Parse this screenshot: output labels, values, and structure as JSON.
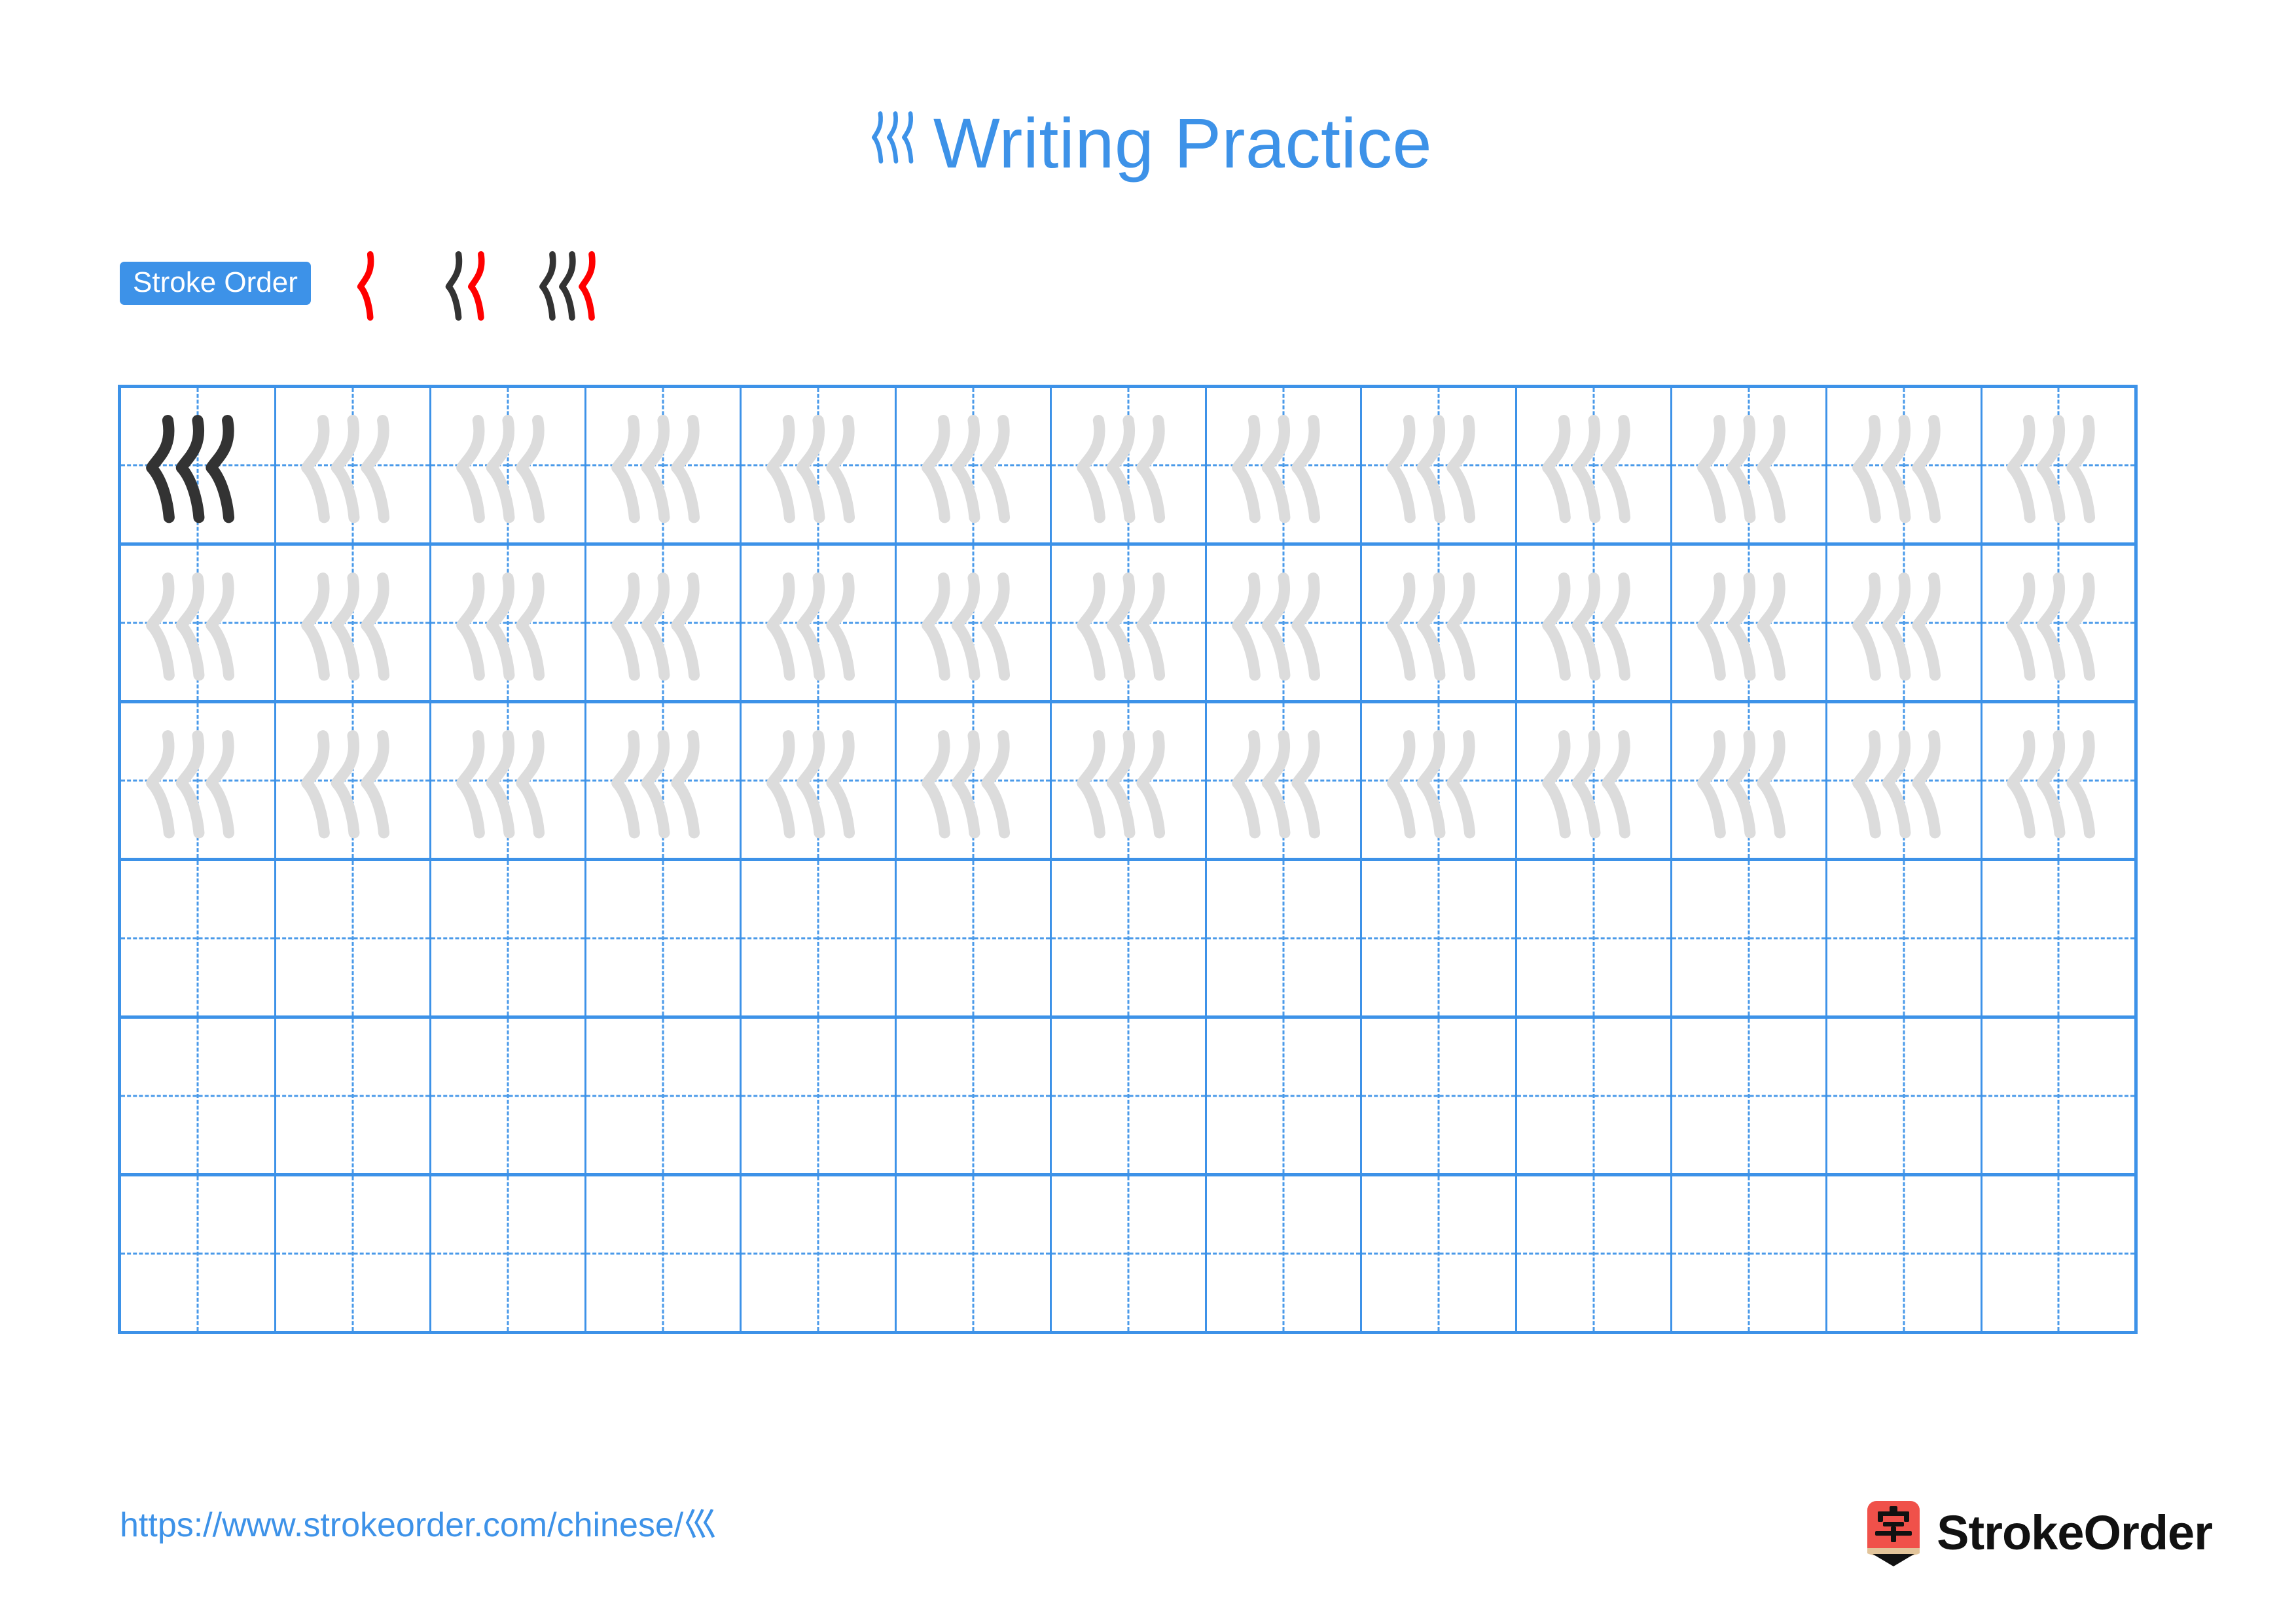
{
  "character": "巛",
  "title": {
    "character": "巛",
    "text": "Writing Practice",
    "color": "#3d92e8"
  },
  "stroke_order": {
    "badge_label": "Stroke Order",
    "badge_bg": "#3d92e8",
    "badge_text_color": "#ffffff",
    "new_stroke_color": "#ff0000",
    "previous_stroke_color": "#333333",
    "total_strokes": 3,
    "steps": [
      {
        "step": 1,
        "strokes_shown": 1,
        "new_stroke_index": 1
      },
      {
        "step": 2,
        "strokes_shown": 2,
        "new_stroke_index": 2
      },
      {
        "step": 3,
        "strokes_shown": 3,
        "new_stroke_index": 3
      }
    ]
  },
  "grid": {
    "rows": 6,
    "columns": 13,
    "line_color": "#3d92e8",
    "guide_color": "#4a9ae9",
    "dark_glyph_color": "#333333",
    "traced_glyph_color": "#dcdcdc",
    "row_fill": [
      "traced",
      "traced",
      "traced",
      "empty",
      "empty",
      "empty"
    ],
    "first_cell_is_dark": true
  },
  "footer": {
    "url": "https://www.strokeorder.com/chinese/巛",
    "brand_name": "StrokeOrder",
    "logo_char": "字",
    "logo_bg": "#f0514a",
    "logo_wood": "#e2c49a",
    "logo_tip": "#111111"
  }
}
